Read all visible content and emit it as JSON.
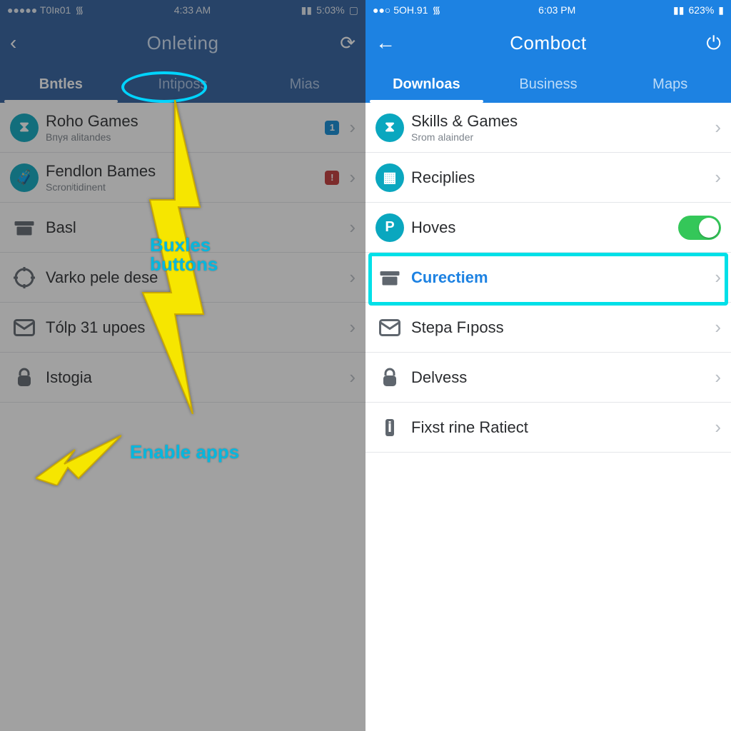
{
  "left": {
    "statusbar": {
      "carrier": "●●●●● T0Iʀ01",
      "wifi": "᯾",
      "time": "4:33 AM",
      "signal": "▮▮",
      "battery_text": "5:03%",
      "battery_icon": "▢"
    },
    "header": {
      "title": "Onleting",
      "action": "⟳"
    },
    "tabs": [
      {
        "label": "Bntles",
        "active": true
      },
      {
        "label": "Intiposs",
        "active": false
      },
      {
        "label": "Mias",
        "active": false
      }
    ],
    "rows": [
      {
        "icon": "hourglass",
        "title": "Roho Games",
        "sub": "Bпγя alitandes",
        "badge": "1",
        "badge_color": "blue"
      },
      {
        "icon": "briefcase",
        "title": "Fendlon Bames",
        "sub": "Scronʲtidinent",
        "badge": "!",
        "badge_color": "red"
      },
      {
        "icon": "archive",
        "title": "Basl"
      },
      {
        "icon": "target",
        "title": "Varko pele dese"
      },
      {
        "icon": "mail",
        "title": "Tólp 31 upoes"
      },
      {
        "icon": "lock",
        "title": "Istogia"
      }
    ],
    "annot": {
      "label1_line1": "Buxles",
      "label1_line2": "buttons",
      "label2": "Enable apps"
    }
  },
  "right": {
    "statusbar": {
      "carrier": "●●○ 5OH.91",
      "wifi": "᯾",
      "time": "6:03 PM",
      "signal": "▮▮",
      "battery_text": "623%",
      "battery_icon": "▮"
    },
    "header": {
      "title": "Comboct",
      "action": "⏻"
    },
    "tabs": [
      {
        "label": "Downloas",
        "active": true
      },
      {
        "label": "Business",
        "active": false
      },
      {
        "label": "Маps",
        "active": false
      }
    ],
    "rows": [
      {
        "icon": "hourglass",
        "title": "Skills & Games",
        "sub": "Srom alainder"
      },
      {
        "icon": "picture",
        "title": "Reciplies"
      },
      {
        "icon": "p",
        "title": "Hoves",
        "toggle": true,
        "highlight": true
      },
      {
        "icon": "archive",
        "title": "Curectiem",
        "accent": true
      },
      {
        "icon": "mail",
        "title": "Stepa Fıposs"
      },
      {
        "icon": "lock",
        "title": "Delvess"
      },
      {
        "icon": "info",
        "title": "Fixst rine Ratiect"
      }
    ]
  }
}
